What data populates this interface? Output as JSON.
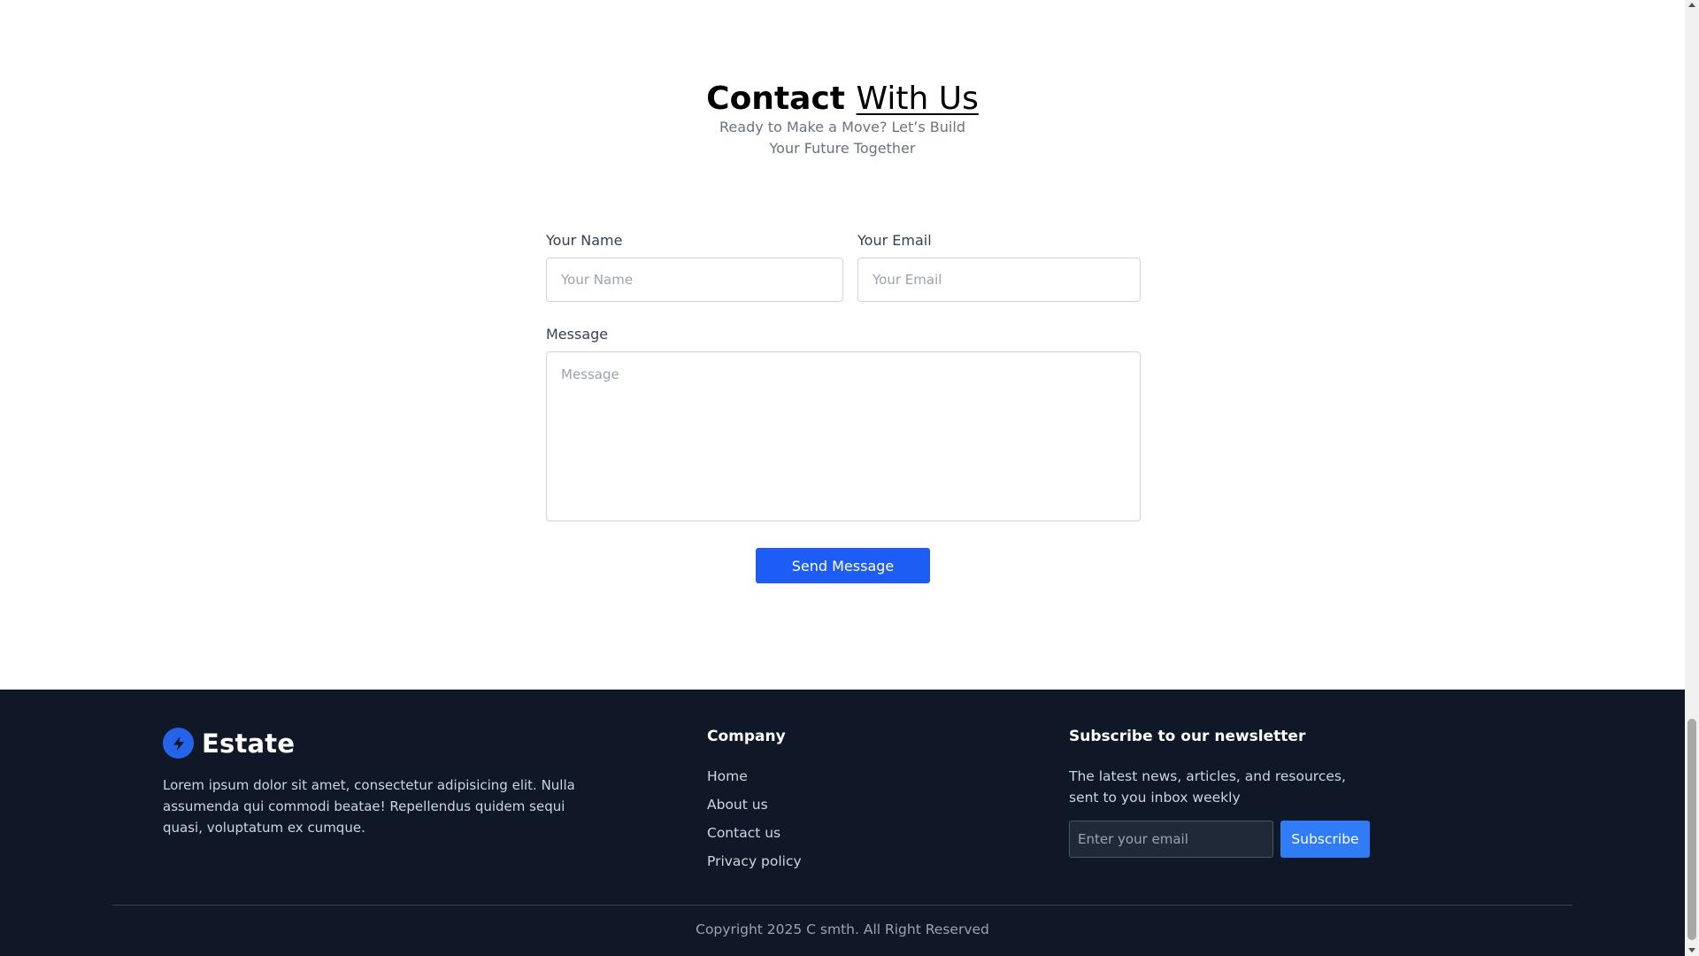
{
  "contact": {
    "title_bold": "Contact",
    "title_light": "With Us",
    "subtitle": "Ready to Make a Move? Let’s Build Your Future Together",
    "name_label": "Your Name",
    "name_placeholder": "Your Name",
    "email_label": "Your Email",
    "email_placeholder": "Your Email",
    "message_label": "Message",
    "message_placeholder": "Message",
    "send_label": "Send Message"
  },
  "footer": {
    "brand": "Estate",
    "about": "Lorem ipsum dolor sit amet, consectetur adipisicing elit. Nulla assumenda qui commodi beatae! Repellendus quidem sequi quasi, voluptatum ex cumque.",
    "company_title": "Company",
    "company_links": [
      "Home",
      "About us",
      "Contact us",
      "Privacy policy"
    ],
    "newsletter_title": "Subscribe to our newsletter",
    "newsletter_desc": "The latest news, articles, and resources, sent to you inbox weekly",
    "email_placeholder": "Enter your email",
    "subscribe_label": "Subscribe",
    "copyright": "Copyright 2025 C smth. All Right Reserved"
  },
  "icons": {
    "logo": "lightning-bolt-icon"
  },
  "colors": {
    "accent": "#1d5cf5",
    "footer_bg": "#101828",
    "subscribe": "#2f7cf6"
  }
}
